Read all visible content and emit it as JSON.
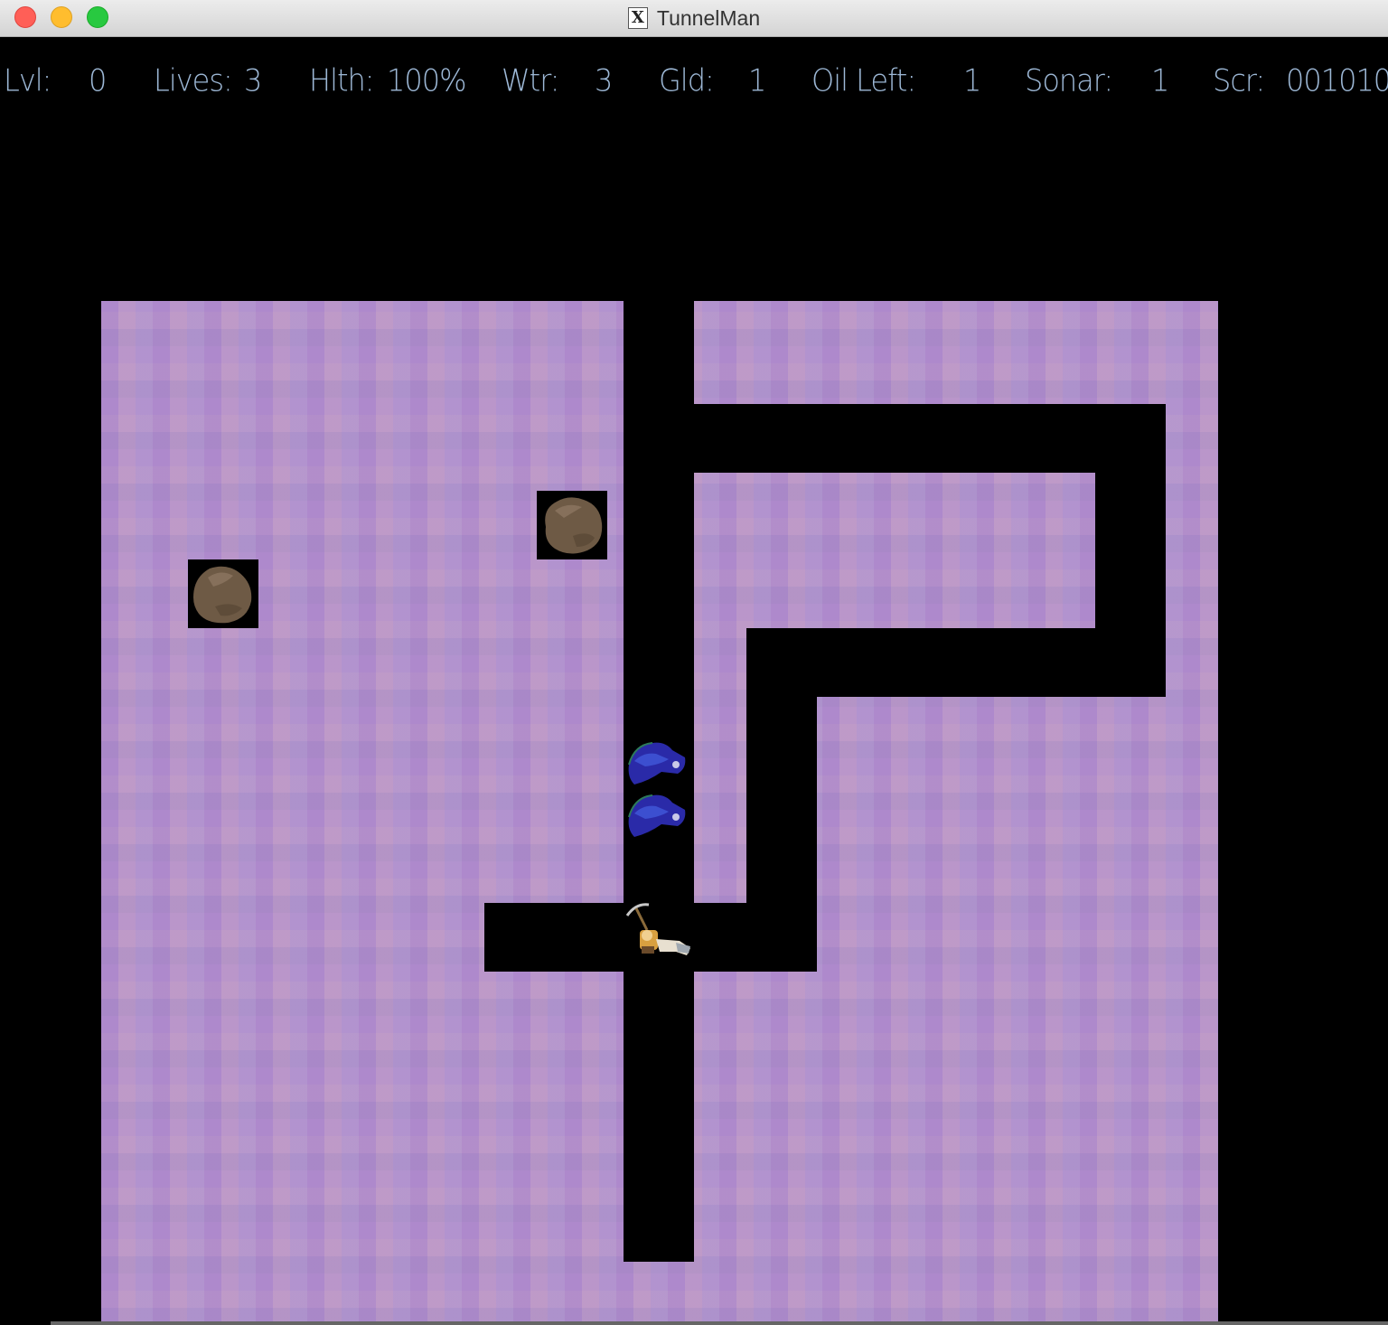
{
  "window": {
    "title": "TunnelMan",
    "icon": "x11-icon"
  },
  "hud": {
    "level_label": "Lvl:",
    "level_value": "0",
    "lives_label": "Lives:",
    "lives_value": "3",
    "health_label": "Hlth:",
    "health_value": "100%",
    "water_label": "Wtr:",
    "water_value": "3",
    "gold_label": "Gld:",
    "gold_value": "1",
    "oil_label": "Oil Left:",
    "oil_value": "1",
    "sonar_label": "Sonar:",
    "sonar_value": "1",
    "score_label": "Scr:",
    "score_value": "001010"
  },
  "colors": {
    "earth": "#b694cc",
    "hud_text": "#9db8d6",
    "tunnel": "#000000"
  },
  "sprites": [
    "boulder",
    "boulder",
    "protester",
    "protester",
    "tunnelman-player"
  ]
}
